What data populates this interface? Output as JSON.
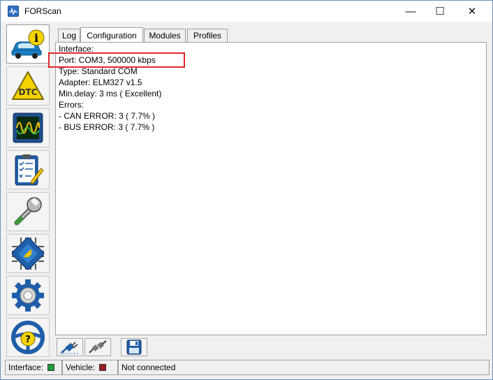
{
  "window": {
    "title": "FORScan"
  },
  "title_buttons": {
    "minimize": "—",
    "maximize": "☐",
    "close": "✕"
  },
  "tabs": [
    {
      "label": "Log"
    },
    {
      "label": "Configuration"
    },
    {
      "label": "Modules"
    },
    {
      "label": "Profiles"
    }
  ],
  "config": {
    "lines": [
      "Interface:",
      "Port: COM3, 500000 kbps",
      "Type: Standard COM",
      "Adapter: ELM327 v1.5",
      "Min.delay: 3 ms ( Excellent)",
      "Errors:",
      "- CAN ERROR: 3 ( 7.7% )",
      "- BUS ERROR: 3 ( 7.7% )"
    ]
  },
  "sidebar": {
    "items": [
      {
        "icon": "vehicle-info-icon"
      },
      {
        "icon": "dtc-icon"
      },
      {
        "icon": "oscilloscope-icon"
      },
      {
        "icon": "checklist-icon"
      },
      {
        "icon": "wrench-icon"
      },
      {
        "icon": "chip-icon"
      },
      {
        "icon": "gear-icon"
      },
      {
        "icon": "help-steering-icon"
      }
    ],
    "dtc_label": "DTC"
  },
  "status": {
    "interface_label": "Interface:",
    "vehicle_label": "Vehicle:",
    "connection_text": "Not connected",
    "interface_color": "#1e9e3a",
    "vehicle_color": "#9e1e1e"
  },
  "colors": {
    "highlight": "#e0282e",
    "accent": "#2f6fbf"
  }
}
